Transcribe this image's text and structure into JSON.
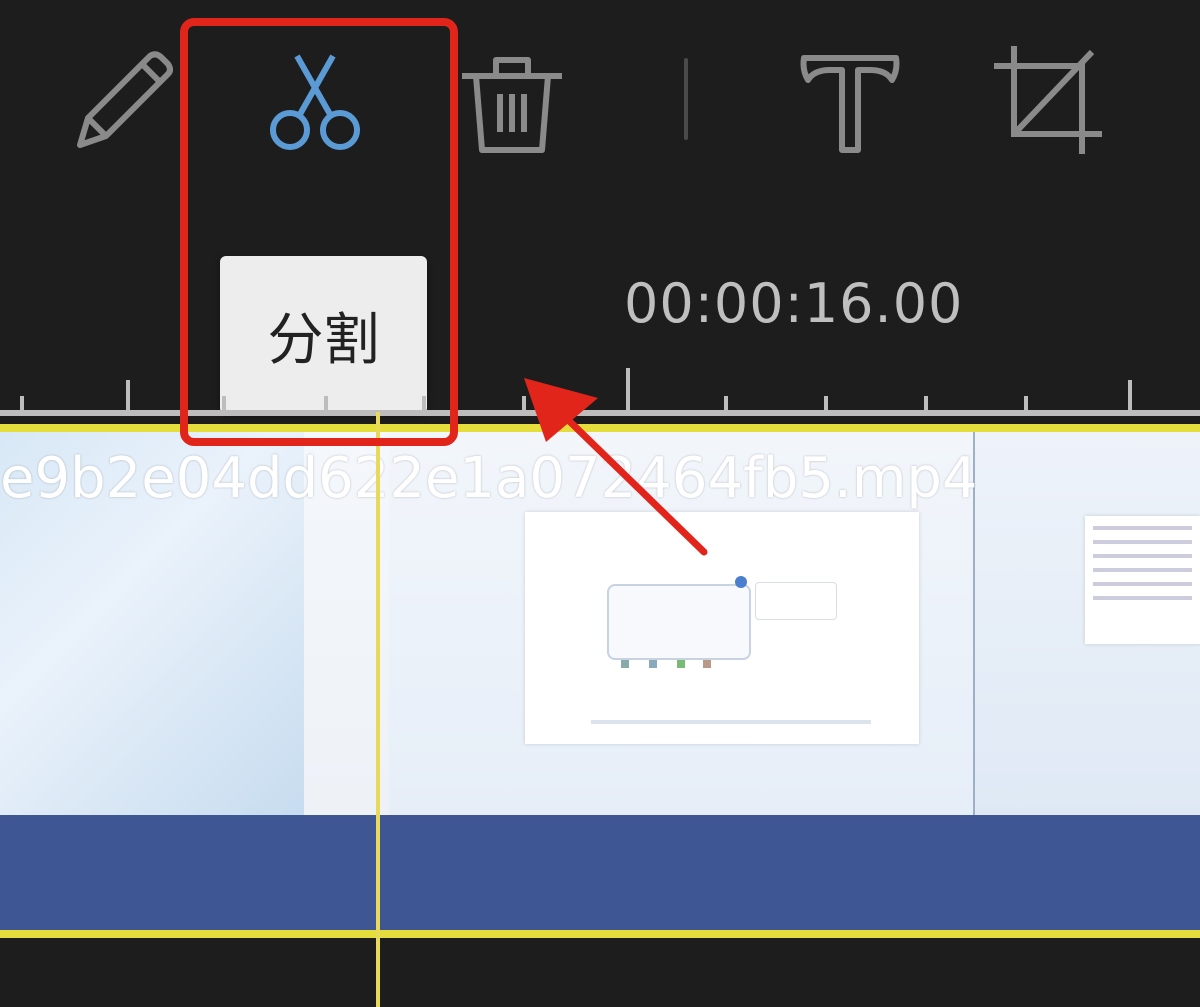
{
  "toolbar": {
    "tools": [
      {
        "name": "edit",
        "icon": "pencil-icon",
        "active": false
      },
      {
        "name": "split",
        "icon": "scissors-icon",
        "active": true
      },
      {
        "name": "delete",
        "icon": "trash-icon",
        "active": false
      },
      {
        "name": "text",
        "icon": "text-t-icon",
        "active": false
      },
      {
        "name": "crop",
        "icon": "crop-icon",
        "active": false
      }
    ]
  },
  "tooltip": {
    "label": "分割"
  },
  "timeline": {
    "timecode": "00:00:16.00",
    "clip_name": "e9b2e04dd622e1a072464fb5.mp4"
  },
  "colors": {
    "background": "#1d1d1d",
    "active_icon": "#5b9bd5",
    "inactive_icon": "#8a8a8a",
    "clip_border": "#e5dd3c",
    "audio_track": "#3f5694",
    "annotation": "#e1251b"
  }
}
